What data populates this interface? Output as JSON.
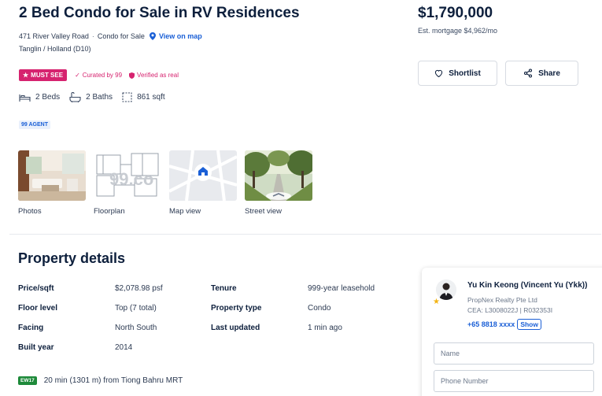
{
  "listing": {
    "title": "2 Bed Condo for Sale in RV Residences",
    "price": "$1,790,000",
    "mortgage": "Est. mortgage $4,962/mo",
    "address": "471 River Valley Road",
    "separator": "·",
    "type": "Condo for Sale",
    "map_link": "View on map",
    "district": "Tanglin / Holland (D10)"
  },
  "badges": {
    "must_see": "MUST SEE",
    "curated": "Curated by 99",
    "verified": "Verified as real"
  },
  "actions": {
    "shortlist": "Shortlist",
    "share": "Share"
  },
  "specs": {
    "beds": "2 Beds",
    "baths": "2 Baths",
    "area": "861 sqft"
  },
  "agent_tag": "99 AGENT",
  "media": [
    {
      "label": "Photos"
    },
    {
      "label": "Floorplan"
    },
    {
      "label": "Map view"
    },
    {
      "label": "Street view"
    }
  ],
  "details": {
    "title": "Property details",
    "left": [
      {
        "key": "Price/sqft",
        "value": "$2,078.98 psf"
      },
      {
        "key": "Floor level",
        "value": "Top (7 total)"
      },
      {
        "key": "Facing",
        "value": "North South"
      },
      {
        "key": "Built year",
        "value": "2014"
      }
    ],
    "right": [
      {
        "key": "Tenure",
        "value": "999-year leasehold"
      },
      {
        "key": "Property type",
        "value": "Condo"
      },
      {
        "key": "Last updated",
        "value": "1 min ago"
      }
    ]
  },
  "mrt": {
    "code": "EW17",
    "text": "20 min (1301 m) from Tiong Bahru MRT"
  },
  "agent": {
    "name": "Yu Kin Keong (Vincent Yu (Ykk))",
    "company": "PropNex Realty Pte Ltd",
    "cea": "CEA: L3008022J | R032353I",
    "phone": "+65 8818 xxxx",
    "show": "Show",
    "name_placeholder": "Name",
    "phone_placeholder": "Phone Number"
  },
  "colors": {
    "brand_blue": "#1a5fd6",
    "must_see_pink": "#d6236f",
    "mrt_green": "#1e8a3a",
    "text_dark": "#0d1f3c"
  }
}
